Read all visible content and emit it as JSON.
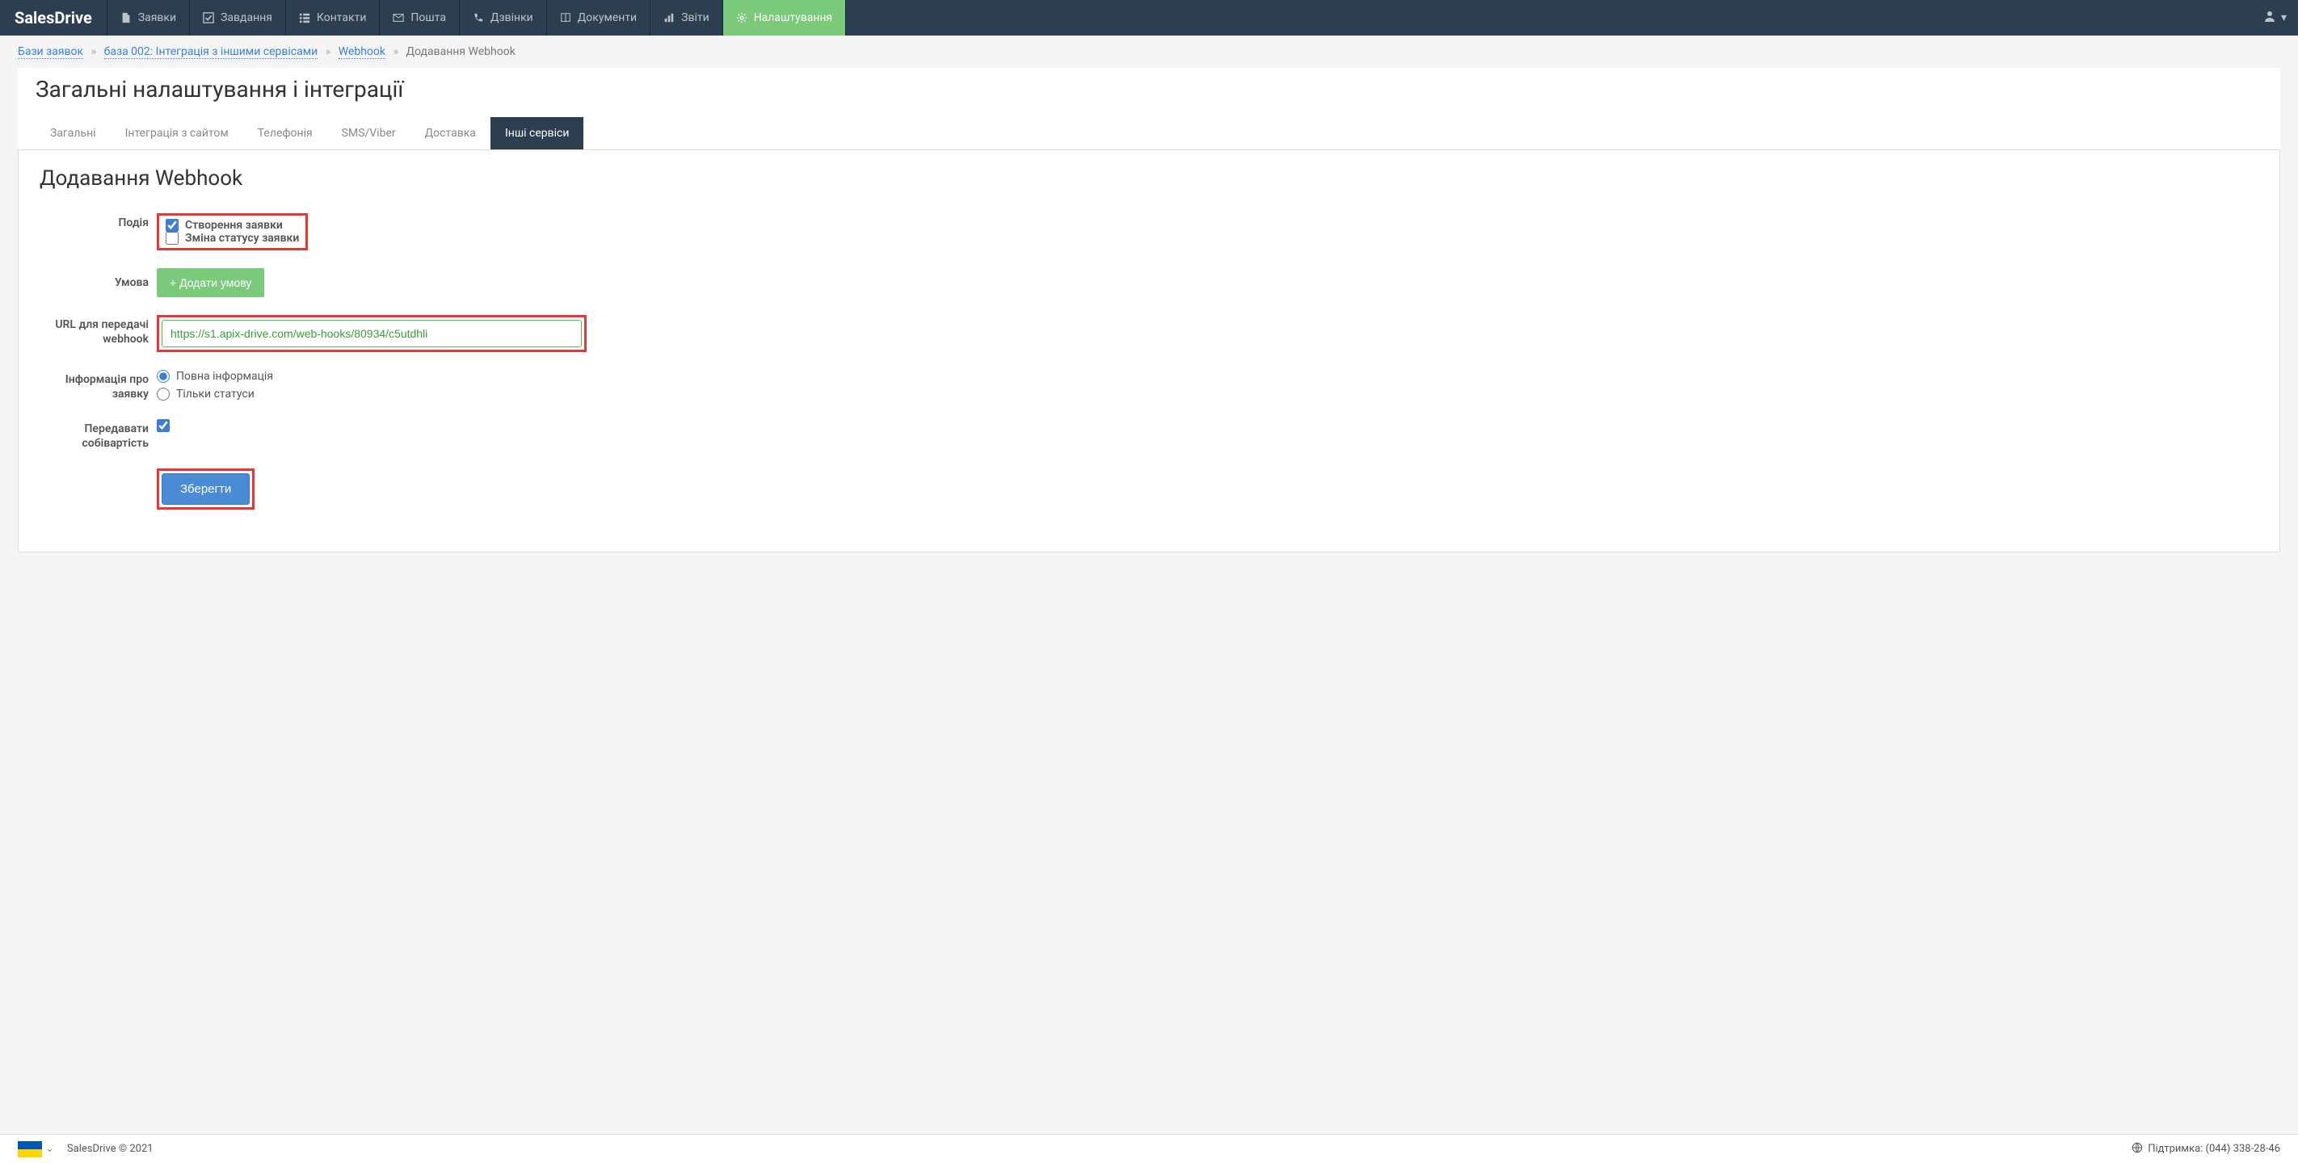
{
  "brand": "SalesDrive",
  "nav": [
    {
      "label": "Заявки",
      "icon": "file"
    },
    {
      "label": "Завдання",
      "icon": "check"
    },
    {
      "label": "Контакти",
      "icon": "list"
    },
    {
      "label": "Пошта",
      "icon": "mail"
    },
    {
      "label": "Дзвінки",
      "icon": "phone"
    },
    {
      "label": "Документи",
      "icon": "book"
    },
    {
      "label": "Звіти",
      "icon": "chart"
    },
    {
      "label": "Налаштування",
      "icon": "gear",
      "active": true
    }
  ],
  "breadcrumb": {
    "items": [
      {
        "label": "Бази заявок",
        "link": true
      },
      {
        "label": "база 002: Інтеграція з іншими сервісами",
        "link": true
      },
      {
        "label": "Webhook",
        "link": true
      },
      {
        "label": "Додавання Webhook",
        "link": false
      }
    ]
  },
  "page_title": "Загальні налаштування і інтеграції",
  "tabs": [
    {
      "label": "Загальні"
    },
    {
      "label": "Інтеграція з сайтом"
    },
    {
      "label": "Телефонія"
    },
    {
      "label": "SMS/Viber"
    },
    {
      "label": "Доставка"
    },
    {
      "label": "Інші сервіси",
      "active": true
    }
  ],
  "panel_title": "Додавання Webhook",
  "form": {
    "event_label": "Подія",
    "event_create": "Створення заявки",
    "event_status": "Зміна статусу заявки",
    "condition_label": "Умова",
    "add_condition_btn": "+ Додати умову",
    "url_label": "URL для передачі webhook",
    "url_value": "https://s1.apix-drive.com/web-hooks/80934/c5utdhli",
    "info_label": "Інформація про заявку",
    "info_full": "Повна інформація",
    "info_status": "Тільки статуси",
    "cost_label": "Передавати собівартість",
    "save_btn": "Зберегти"
  },
  "footer": {
    "copyright": "SalesDrive © 2021",
    "support": "Підтримка: (044) 338-28-46"
  }
}
